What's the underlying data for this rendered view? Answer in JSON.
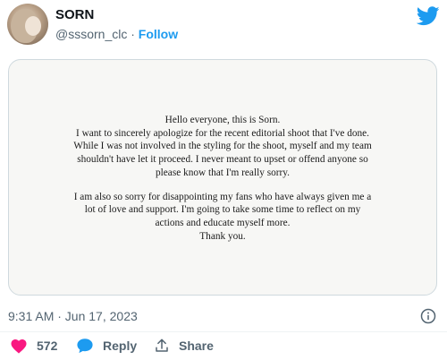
{
  "author": {
    "display_name": "SORN",
    "handle": "@sssorn_clc",
    "separator": " · ",
    "follow_label": "Follow"
  },
  "statement": {
    "paragraph1": [
      "Hello everyone, this is Sorn.",
      "I want to sincerely apologize for the recent editorial shoot that I've done.",
      "While I was not involved in the styling for the shoot, myself and my team",
      "shouldn't have let it proceed. I never meant to upset or offend anyone so",
      "please know that I'm really sorry."
    ],
    "paragraph2": [
      "I am also so sorry for disappointing my fans who have always given me a",
      "lot of love and support. I'm going to take some time to reflect on my",
      "actions and educate myself more.",
      "Thank you."
    ]
  },
  "timestamp": "9:31 AM · Jun 17, 2023",
  "actions": {
    "like_count": "572",
    "reply_label": "Reply",
    "share_label": "Share"
  },
  "colors": {
    "like": "#f91880",
    "reply": "#1d9bf0",
    "follow": "#1d9bf0",
    "twitter_brand": "#1d9bf0",
    "muted": "#536471"
  },
  "icons": {
    "brand": "twitter-bird-icon",
    "like": "heart-icon",
    "reply": "speech-bubble-icon",
    "share": "share-upload-icon",
    "info": "info-icon"
  }
}
